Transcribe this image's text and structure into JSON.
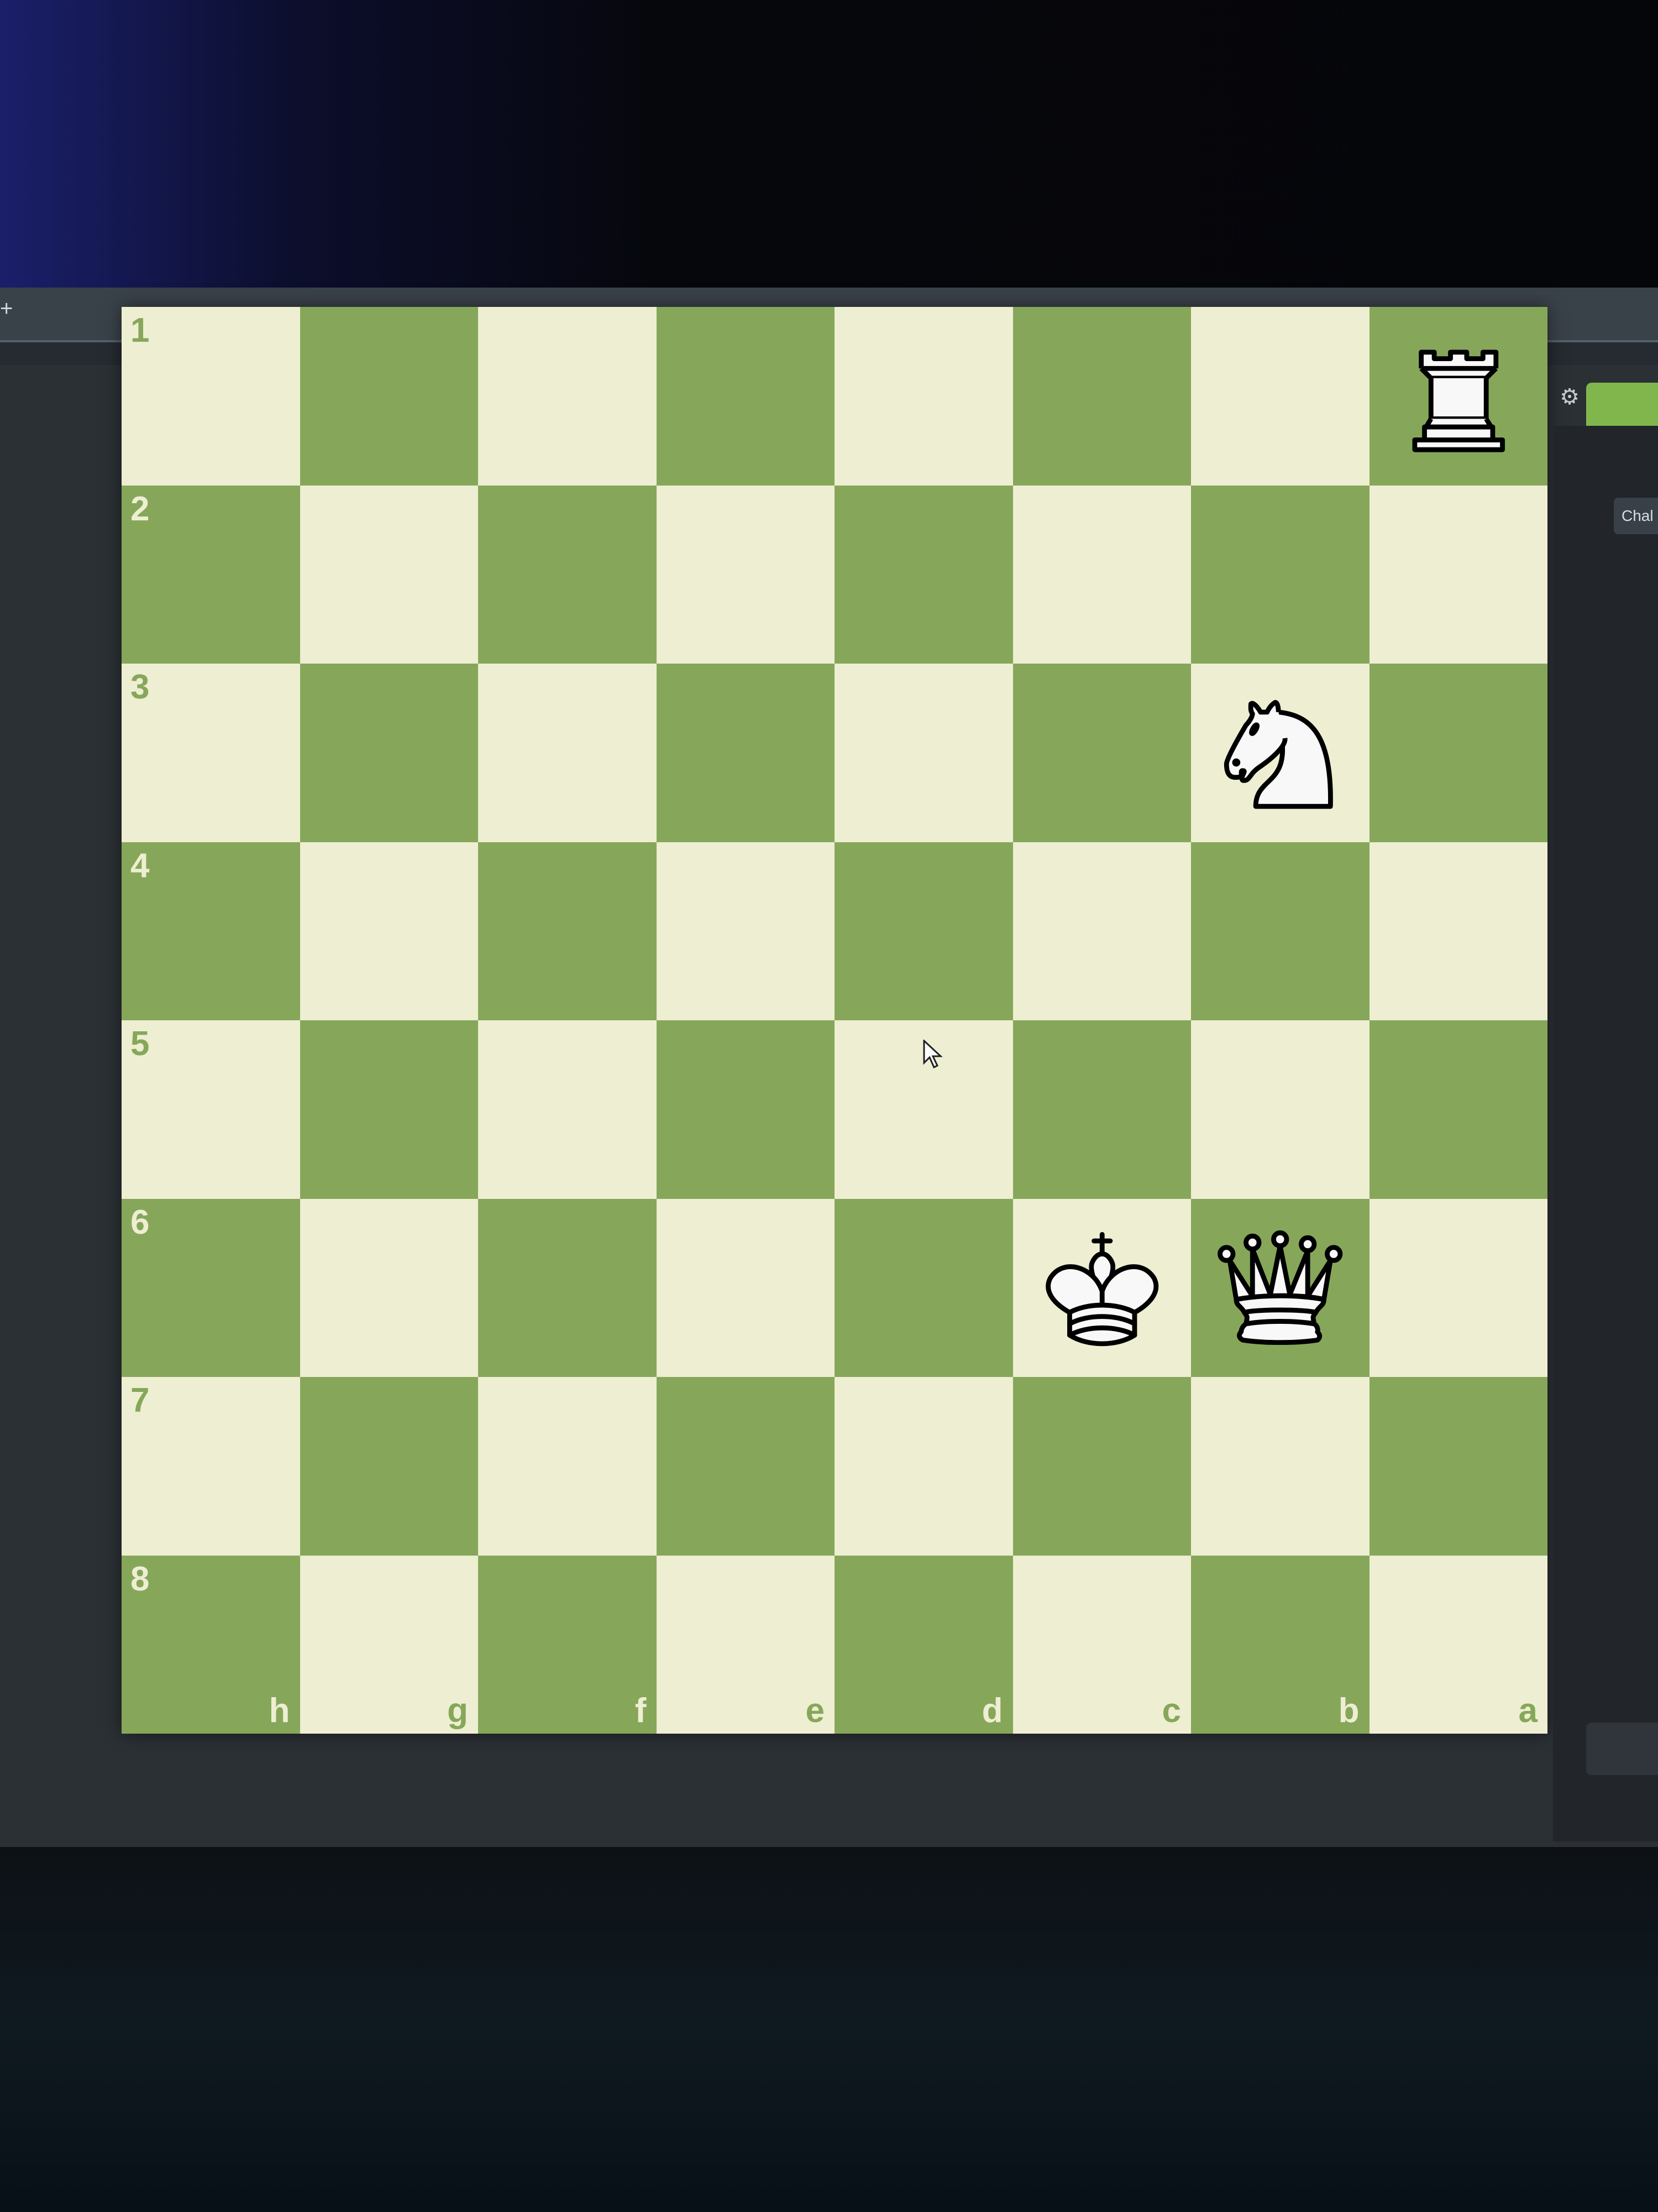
{
  "browser": {
    "new_tab_icon": "+"
  },
  "board": {
    "orientation": "black-perspective",
    "light_color": "#eeeed2",
    "dark_color": "#86a75a",
    "ranks": [
      "1",
      "2",
      "3",
      "4",
      "5",
      "6",
      "7",
      "8"
    ],
    "files": [
      "h",
      "g",
      "f",
      "e",
      "d",
      "c",
      "b",
      "a"
    ],
    "pieces": [
      {
        "square": "a1",
        "color": "white",
        "type": "rook"
      },
      {
        "square": "b3",
        "color": "white",
        "type": "knight"
      },
      {
        "square": "c6",
        "color": "white",
        "type": "king"
      },
      {
        "square": "b6",
        "color": "white",
        "type": "queen"
      }
    ]
  },
  "side_panel": {
    "settings_icon": "gear-icon",
    "challenge_tab": "Chal",
    "play_color": "#81b64c"
  }
}
